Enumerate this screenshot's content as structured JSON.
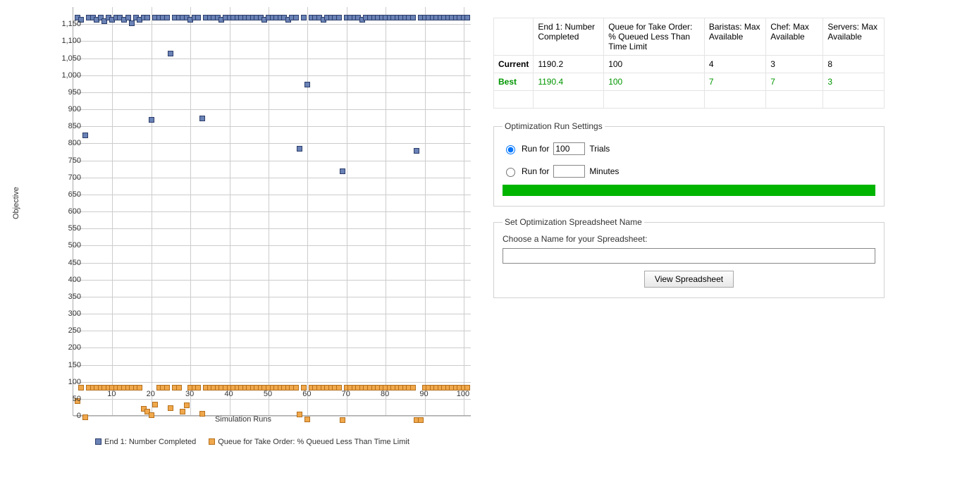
{
  "chart_data": {
    "type": "scatter",
    "xlabel": "Simulation Runs",
    "ylabel": "Objective",
    "xlim": [
      0,
      102
    ],
    "ylim": [
      0,
      1200
    ],
    "xticks": [
      10,
      20,
      30,
      40,
      50,
      60,
      70,
      80,
      90,
      100
    ],
    "yticks": [
      0,
      50,
      100,
      150,
      200,
      250,
      300,
      350,
      400,
      450,
      500,
      550,
      600,
      650,
      700,
      750,
      800,
      850,
      900,
      950,
      1000,
      1050,
      1100,
      1150
    ],
    "series": [
      {
        "name": "End 1: Number Completed",
        "color": "blue",
        "points": [
          [
            1,
            1185
          ],
          [
            2,
            1180
          ],
          [
            3,
            840
          ],
          [
            4,
            1185
          ],
          [
            5,
            1185
          ],
          [
            6,
            1180
          ],
          [
            7,
            1185
          ],
          [
            8,
            1175
          ],
          [
            9,
            1185
          ],
          [
            10,
            1180
          ],
          [
            11,
            1185
          ],
          [
            12,
            1185
          ],
          [
            13,
            1180
          ],
          [
            14,
            1185
          ],
          [
            15,
            1170
          ],
          [
            16,
            1185
          ],
          [
            17,
            1180
          ],
          [
            18,
            1185
          ],
          [
            19,
            1185
          ],
          [
            20,
            885
          ],
          [
            21,
            1185
          ],
          [
            22,
            1185
          ],
          [
            23,
            1185
          ],
          [
            24,
            1185
          ],
          [
            25,
            1080
          ],
          [
            26,
            1185
          ],
          [
            27,
            1185
          ],
          [
            28,
            1185
          ],
          [
            29,
            1185
          ],
          [
            30,
            1180
          ],
          [
            31,
            1185
          ],
          [
            32,
            1185
          ],
          [
            33,
            890
          ],
          [
            34,
            1185
          ],
          [
            35,
            1185
          ],
          [
            36,
            1185
          ],
          [
            37,
            1185
          ],
          [
            38,
            1180
          ],
          [
            39,
            1185
          ],
          [
            40,
            1185
          ],
          [
            41,
            1185
          ],
          [
            42,
            1185
          ],
          [
            43,
            1185
          ],
          [
            44,
            1185
          ],
          [
            45,
            1185
          ],
          [
            46,
            1185
          ],
          [
            47,
            1185
          ],
          [
            48,
            1185
          ],
          [
            49,
            1180
          ],
          [
            50,
            1185
          ],
          [
            51,
            1185
          ],
          [
            52,
            1185
          ],
          [
            53,
            1185
          ],
          [
            54,
            1185
          ],
          [
            55,
            1180
          ],
          [
            56,
            1185
          ],
          [
            57,
            1185
          ],
          [
            58,
            800
          ],
          [
            59,
            1185
          ],
          [
            60,
            990
          ],
          [
            61,
            1185
          ],
          [
            62,
            1185
          ],
          [
            63,
            1185
          ],
          [
            64,
            1180
          ],
          [
            65,
            1185
          ],
          [
            66,
            1185
          ],
          [
            67,
            1185
          ],
          [
            68,
            1185
          ],
          [
            69,
            735
          ],
          [
            70,
            1185
          ],
          [
            71,
            1185
          ],
          [
            72,
            1185
          ],
          [
            73,
            1185
          ],
          [
            74,
            1180
          ],
          [
            75,
            1185
          ],
          [
            76,
            1185
          ],
          [
            77,
            1185
          ],
          [
            78,
            1185
          ],
          [
            79,
            1185
          ],
          [
            80,
            1185
          ],
          [
            81,
            1185
          ],
          [
            82,
            1185
          ],
          [
            83,
            1185
          ],
          [
            84,
            1185
          ],
          [
            85,
            1185
          ],
          [
            86,
            1185
          ],
          [
            87,
            1185
          ],
          [
            88,
            795
          ],
          [
            89,
            1185
          ],
          [
            90,
            1185
          ],
          [
            91,
            1185
          ],
          [
            92,
            1185
          ],
          [
            93,
            1185
          ],
          [
            94,
            1185
          ],
          [
            95,
            1185
          ],
          [
            96,
            1185
          ],
          [
            97,
            1185
          ],
          [
            98,
            1185
          ],
          [
            99,
            1185
          ],
          [
            100,
            1185
          ],
          [
            101,
            1185
          ]
        ]
      },
      {
        "name": "Queue for Take Order: % Queued Less Than Time Limit",
        "color": "orange",
        "points": [
          [
            1,
            60
          ],
          [
            2,
            100
          ],
          [
            3,
            12
          ],
          [
            4,
            100
          ],
          [
            5,
            100
          ],
          [
            6,
            100
          ],
          [
            7,
            100
          ],
          [
            8,
            100
          ],
          [
            9,
            100
          ],
          [
            10,
            100
          ],
          [
            11,
            100
          ],
          [
            12,
            100
          ],
          [
            13,
            100
          ],
          [
            14,
            100
          ],
          [
            15,
            100
          ],
          [
            16,
            100
          ],
          [
            17,
            100
          ],
          [
            18,
            38
          ],
          [
            19,
            28
          ],
          [
            20,
            18
          ],
          [
            21,
            50
          ],
          [
            22,
            100
          ],
          [
            23,
            100
          ],
          [
            24,
            100
          ],
          [
            25,
            40
          ],
          [
            26,
            100
          ],
          [
            27,
            100
          ],
          [
            28,
            30
          ],
          [
            29,
            48
          ],
          [
            30,
            100
          ],
          [
            31,
            100
          ],
          [
            32,
            100
          ],
          [
            33,
            22
          ],
          [
            34,
            100
          ],
          [
            35,
            100
          ],
          [
            36,
            100
          ],
          [
            37,
            100
          ],
          [
            38,
            100
          ],
          [
            39,
            100
          ],
          [
            40,
            100
          ],
          [
            41,
            100
          ],
          [
            42,
            100
          ],
          [
            43,
            100
          ],
          [
            44,
            100
          ],
          [
            45,
            100
          ],
          [
            46,
            100
          ],
          [
            47,
            100
          ],
          [
            48,
            100
          ],
          [
            49,
            100
          ],
          [
            50,
            100
          ],
          [
            51,
            100
          ],
          [
            52,
            100
          ],
          [
            53,
            100
          ],
          [
            54,
            100
          ],
          [
            55,
            100
          ],
          [
            56,
            100
          ],
          [
            57,
            100
          ],
          [
            58,
            20
          ],
          [
            59,
            100
          ],
          [
            60,
            6
          ],
          [
            61,
            100
          ],
          [
            62,
            100
          ],
          [
            63,
            100
          ],
          [
            64,
            100
          ],
          [
            65,
            100
          ],
          [
            66,
            100
          ],
          [
            67,
            100
          ],
          [
            68,
            100
          ],
          [
            69,
            5
          ],
          [
            70,
            100
          ],
          [
            71,
            100
          ],
          [
            72,
            100
          ],
          [
            73,
            100
          ],
          [
            74,
            100
          ],
          [
            75,
            100
          ],
          [
            76,
            100
          ],
          [
            77,
            100
          ],
          [
            78,
            100
          ],
          [
            79,
            100
          ],
          [
            80,
            100
          ],
          [
            81,
            100
          ],
          [
            82,
            100
          ],
          [
            83,
            100
          ],
          [
            84,
            100
          ],
          [
            85,
            100
          ],
          [
            86,
            100
          ],
          [
            87,
            100
          ],
          [
            88,
            5
          ],
          [
            89,
            5
          ],
          [
            90,
            100
          ],
          [
            91,
            100
          ],
          [
            92,
            100
          ],
          [
            93,
            100
          ],
          [
            94,
            100
          ],
          [
            95,
            100
          ],
          [
            96,
            100
          ],
          [
            97,
            100
          ],
          [
            98,
            100
          ],
          [
            99,
            100
          ],
          [
            100,
            100
          ],
          [
            101,
            100
          ]
        ]
      }
    ]
  },
  "legend": {
    "s1": "End 1: Number Completed",
    "s2": "Queue for Take Order: % Queued Less Than Time Limit"
  },
  "results": {
    "headers": [
      "",
      "End 1: Number Completed",
      "Queue for Take Order: % Queued Less Than Time Limit",
      "Baristas: Max Available",
      "Chef: Max Available",
      "Servers: Max Available"
    ],
    "rows": [
      {
        "label": "Current",
        "values": [
          "1190.2",
          "100",
          "4",
          "3",
          "8"
        ],
        "style": "current"
      },
      {
        "label": "Best",
        "values": [
          "1190.4",
          "100",
          "7",
          "7",
          "3"
        ],
        "style": "best"
      }
    ]
  },
  "settings": {
    "legend": "Optimization Run Settings",
    "runfor_label": "Run for",
    "trials_value": "100",
    "trials_suffix": "Trials",
    "minutes_value": "",
    "minutes_suffix": "Minutes"
  },
  "spreadsheet": {
    "legend": "Set Optimization Spreadsheet Name",
    "prompt": "Choose a Name for your Spreadsheet:",
    "value": "",
    "button": "View Spreadsheet"
  }
}
